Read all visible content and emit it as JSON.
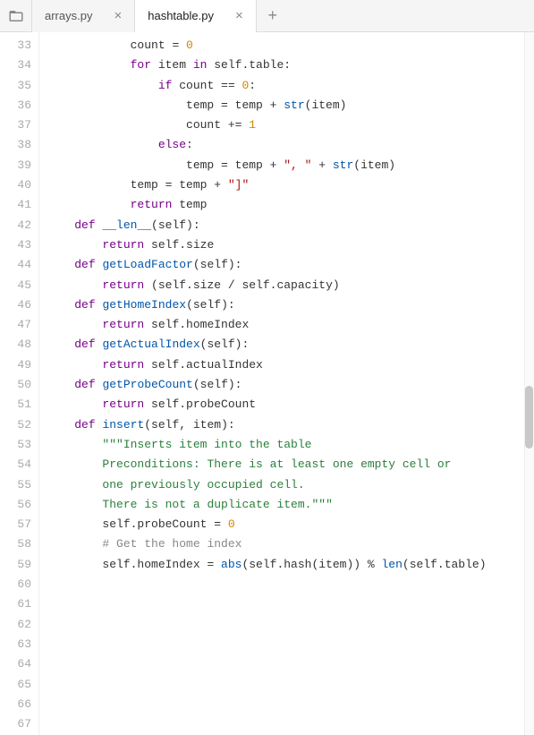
{
  "tabs": {
    "t0": {
      "label": "arrays.py"
    },
    "t1": {
      "label": "hashtable.py"
    }
  },
  "lines": {
    "start": 33,
    "end": 67
  },
  "code": {
    "l33": {
      "indent": "            ",
      "t1": "count",
      "t2": " = ",
      "t3": "0"
    },
    "l34": {
      "indent": ""
    },
    "l35": {
      "indent": "            ",
      "t1": "for",
      "t2": " item ",
      "t3": "in",
      "t4": " self.table:"
    },
    "l36": {
      "indent": "                ",
      "t1": "if",
      "t2": " count == ",
      "t3": "0",
      "t4": ":"
    },
    "l37": {
      "indent": "                    ",
      "t1": "temp = temp + ",
      "t2": "str",
      "t3": "(item)"
    },
    "l38": {
      "indent": "                    ",
      "t1": "count += ",
      "t2": "1"
    },
    "l39": {
      "indent": "                ",
      "t1": "else",
      "t2": ":"
    },
    "l40": {
      "indent": "                    ",
      "t1": "temp = temp + ",
      "t2": "\", \"",
      "t3": " + ",
      "t4": "str",
      "t5": "(item)"
    },
    "l41": {
      "indent": "            ",
      "t1": "temp = temp + ",
      "t2": "\"]\""
    },
    "l42": {
      "indent": ""
    },
    "l43": {
      "indent": "            ",
      "t1": "return",
      "t2": " temp"
    },
    "l44": {
      "indent": ""
    },
    "l45": {
      "indent": "    ",
      "t1": "def",
      "t2": " ",
      "t3": "__len__",
      "t4": "(self):"
    },
    "l46": {
      "indent": "        ",
      "t1": "return",
      "t2": " self.size"
    },
    "l47": {
      "indent": ""
    },
    "l48": {
      "indent": "    ",
      "t1": "def",
      "t2": " ",
      "t3": "getLoadFactor",
      "t4": "(self):"
    },
    "l49": {
      "indent": "        ",
      "t1": "return",
      "t2": " (self.size / self.capacity)"
    },
    "l50": {
      "indent": ""
    },
    "l51": {
      "indent": "    ",
      "t1": "def",
      "t2": " ",
      "t3": "getHomeIndex",
      "t4": "(self):"
    },
    "l52": {
      "indent": "        ",
      "t1": "return",
      "t2": " self.homeIndex"
    },
    "l53": {
      "indent": ""
    },
    "l54": {
      "indent": "    ",
      "t1": "def",
      "t2": " ",
      "t3": "getActualIndex",
      "t4": "(self):"
    },
    "l55": {
      "indent": "        ",
      "t1": "return",
      "t2": " self.actualIndex"
    },
    "l56": {
      "indent": ""
    },
    "l57": {
      "indent": "    ",
      "t1": "def",
      "t2": " ",
      "t3": "getProbeCount",
      "t4": "(self):"
    },
    "l58": {
      "indent": "        ",
      "t1": "return",
      "t2": " self.probeCount"
    },
    "l59": {
      "indent": ""
    },
    "l60": {
      "indent": "    ",
      "t1": "def",
      "t2": " ",
      "t3": "insert",
      "t4": "(self, item):"
    },
    "l61": {
      "indent": "        ",
      "t1": "\"\"\"Inserts item into the table"
    },
    "l62": {
      "indent": "        ",
      "t1": "Preconditions: There is at least one empty cell or"
    },
    "l63": {
      "indent": "        ",
      "t1": "one previously occupied cell."
    },
    "l64": {
      "indent": "        ",
      "t1": "There is not a duplicate item.\"\"\""
    },
    "l65": {
      "indent": "        ",
      "t1": "self.probeCount = ",
      "t2": "0"
    },
    "l66": {
      "indent": "        ",
      "t1": "# Get the home index"
    },
    "l67": {
      "indent": "        ",
      "t1": "self.homeIndex = ",
      "t2": "abs",
      "t3": "(self.hash(item)) % ",
      "t4": "len",
      "t5": "(self.table)"
    }
  }
}
